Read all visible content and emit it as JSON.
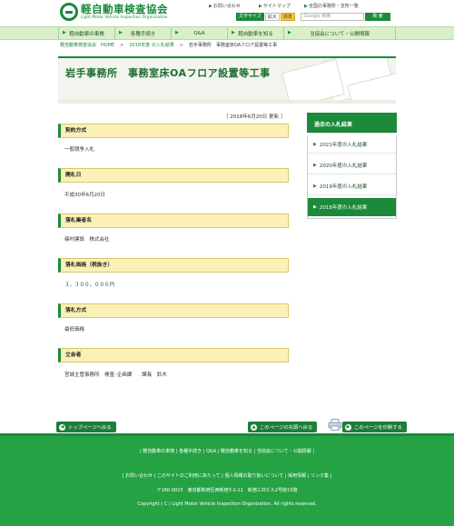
{
  "header": {
    "logo_name": "軽自動車検査協会",
    "logo_sub": "Light Motor Vehicle Inspection Organization",
    "links": [
      "お問い合わせ",
      "サイトマップ",
      "全国の事務所・支所一覧"
    ],
    "font_size_label": "文字サイズ",
    "font_big": "拡大",
    "font_std": "標準",
    "search_placeholder": "Google 検索",
    "search_button": "検 索"
  },
  "nav": [
    "軽自動車の車検",
    "各種手続き",
    "Q&A",
    "軽自動車を知る",
    "当協会について・公開情報"
  ],
  "breadcrumb": {
    "home": "軽自動車検査協会　HOME",
    "sep": ">",
    "parent": "2018年度 の入札結果",
    "current": "岩手事務所　事務室床OAフロア設置等工事"
  },
  "page": {
    "title": "岩手事務所　事務室床OAフロア設置等工事",
    "updated": "［ 2018年6月20日 更新 ］"
  },
  "sections": [
    {
      "heading": "契約方式",
      "body": "一般競争入札"
    },
    {
      "heading": "開札日",
      "body": "平成30年6月20日"
    },
    {
      "heading": "落札業者名",
      "body": "篠村建設　株式会社"
    },
    {
      "heading": "落札価格（税抜き）",
      "body": "３，３００，０００円"
    },
    {
      "heading": "落札方式",
      "body": "最低価格"
    },
    {
      "heading": "立会者",
      "body": "宮城主管事務所　検査･企画課　　課長　鈴木"
    }
  ],
  "sidebar": {
    "title": "過去の入札結果",
    "years": [
      "2021年度の入札結果",
      "2020年度の入札結果",
      "2019年度の入札結果",
      "2018年度の入札結果"
    ],
    "active_index": 3
  },
  "buttons": {
    "top": "トップページへ戻る",
    "page_top": "このページの先頭へ戻る",
    "print": "このページを印刷する"
  },
  "footer": {
    "nav": "| 軽自動車の車検 | 各種手続き | Q&A | 軽自動車を知る | 当協会について・公開情報 |",
    "links": "| お問い合わせ | このサイトのご利用にあたって | 個人情報の取り扱いについて | 採用情報 | リンク集 |",
    "address": "〒160-0023　東京都新宿区西新宿3-2-11　新宿三井ビル2号館15階",
    "copyright": "Copyright ( C ) Light Motor Vehicle Inspection Organization. All rights reserved."
  },
  "colors": {
    "brand_green": "#1b8a3a",
    "footer_green": "#25a244",
    "section_yellow": "#fbf1b7",
    "nav_green": "#d8efc9"
  }
}
